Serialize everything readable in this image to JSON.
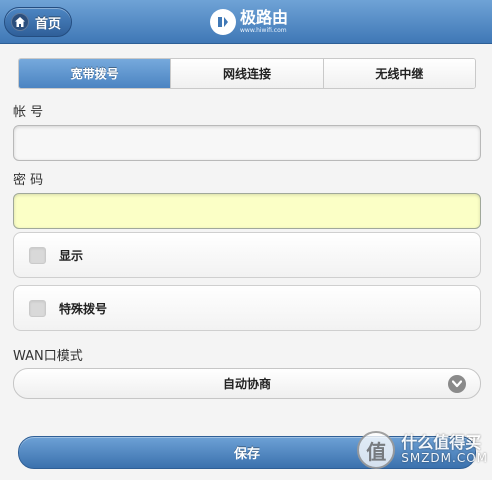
{
  "header": {
    "home_label": "首页",
    "logo_name": "极路由",
    "logo_url": "www.hiwifi.com",
    "logo_mark": "极"
  },
  "tabs": [
    {
      "label": "宽带拨号",
      "active": true
    },
    {
      "label": "网线连接",
      "active": false
    },
    {
      "label": "无线中继",
      "active": false
    }
  ],
  "form": {
    "account_label": "帐 号",
    "account_value": "",
    "password_label": "密 码",
    "password_value": "",
    "show_label": "显示",
    "show_checked": false,
    "special_dial_label": "特殊拨号",
    "special_dial_checked": false,
    "wan_mode_label": "WAN口模式",
    "wan_mode_value": "自动协商",
    "save_label": "保存"
  },
  "watermark": {
    "badge": "值",
    "text_cn": "什么值得买",
    "text_en": "SMZDM.COM"
  },
  "icons": {
    "home": "home-icon",
    "select_arrow": "chevron-down-icon"
  },
  "colors": {
    "header_blue": "#3f78b6",
    "active_tab": "#4b84c2",
    "focused_input": "#fbffc6"
  }
}
